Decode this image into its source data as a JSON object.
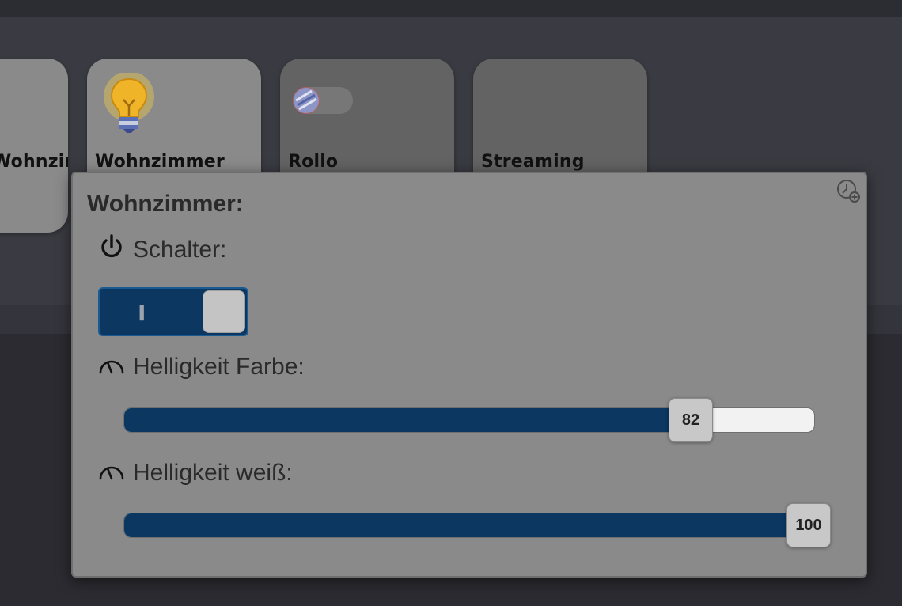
{
  "tiles": [
    {
      "label": "Wohnzimmer"
    },
    {
      "label": "Wohnzimmer"
    },
    {
      "label": "Rollo"
    },
    {
      "label": "Streaming"
    }
  ],
  "tile_icons": {
    "wohnzimmer": "lightbulb-icon",
    "rollo": "blind-toggle-icon"
  },
  "dialog": {
    "title": "Wohnzimmer:",
    "history_icon": "clock-plus-icon",
    "switch_row": {
      "icon": "power-icon",
      "label": "Schalter:",
      "state_text": "I",
      "state": "on"
    },
    "color_brightness": {
      "icon": "gauge-icon",
      "label": "Helligkeit Farbe:",
      "value": 82,
      "value_text": "82",
      "max": 100
    },
    "white_brightness": {
      "icon": "gauge-icon",
      "label": "Helligkeit weiß:",
      "value": 100,
      "value_text": "100",
      "max": 100
    }
  },
  "colors": {
    "accent": "#0b3760",
    "dialog_bg": "#8a8a8a",
    "page_bg": "#2a2a30"
  }
}
